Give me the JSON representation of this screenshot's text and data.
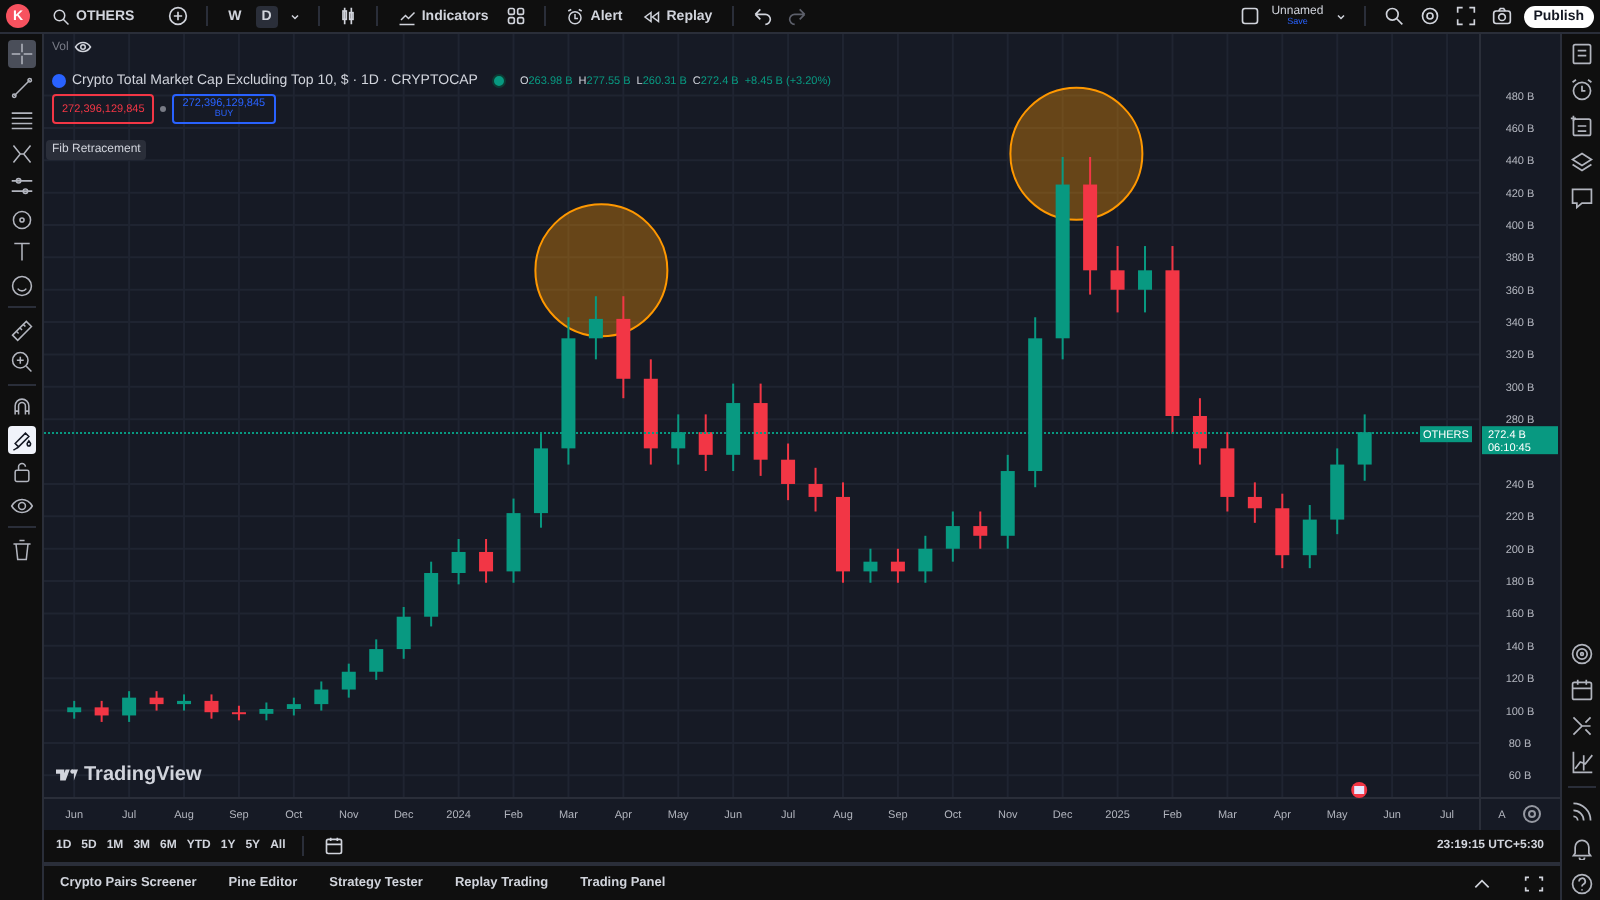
{
  "top_bar": {
    "avatar": "K",
    "symbol": "OTHERS",
    "intervals": [
      {
        "label": "W",
        "selected": false
      },
      {
        "label": "D",
        "selected": true
      }
    ],
    "indicators_label": "Indicators",
    "alert_label": "Alert",
    "replay_label": "Replay",
    "layout": {
      "name": "Unnamed",
      "status": "Save"
    },
    "publish_label": "Publish"
  },
  "left_toolbar": [
    {
      "kind": "crosshair",
      "selected": true,
      "on": false
    },
    {
      "kind": "trendline",
      "selected": false,
      "on": false
    },
    {
      "kind": "fib",
      "selected": false,
      "on": false
    },
    {
      "kind": "pattern",
      "selected": false,
      "on": false
    },
    {
      "kind": "sliders",
      "selected": false,
      "on": false
    },
    {
      "kind": "shapes",
      "selected": false,
      "on": false
    },
    {
      "kind": "text",
      "selected": false,
      "on": false
    },
    {
      "kind": "emoji",
      "selected": false,
      "on": false
    },
    {
      "kind": "ruler",
      "selected": false,
      "on": false
    },
    {
      "kind": "zoom",
      "selected": false,
      "on": false
    },
    {
      "kind": "magnet",
      "selected": false,
      "on": false
    },
    {
      "kind": "brush",
      "selected": false,
      "on": true
    },
    {
      "kind": "lock",
      "selected": false,
      "on": false
    },
    {
      "kind": "eye",
      "selected": false,
      "on": false
    },
    {
      "kind": "trash",
      "selected": false,
      "on": false
    }
  ],
  "chart": {
    "vol_label": "Vol",
    "legend": {
      "title": "Crypto Total Market Cap Excluding Top 10, $ · 1D · CRYPTOCAP",
      "ohlc": [
        {
          "key": "O",
          "value": "263.98 B"
        },
        {
          "key": "H",
          "value": "277.55 B"
        },
        {
          "key": "L",
          "value": "260.31 B"
        },
        {
          "key": "C",
          "value": "272.4 B"
        }
      ],
      "change": "+8.45 B (+3.20%)"
    },
    "sell_price": "272,396,129,845",
    "buy_price": "272,396,129,845",
    "buy_label": "BUY",
    "tooltip": "Fib Retracement",
    "symbol_tag": "OTHERS",
    "price_tag": "272.4 B",
    "countdown": "06:10:45",
    "logo": "TradingView",
    "chart_data": {
      "type": "candlestick",
      "categories": [
        "Jun",
        null,
        "Jul",
        null,
        "Aug",
        null,
        "Sep",
        null,
        "Oct",
        null,
        "Nov",
        null,
        "Dec",
        null,
        "2024",
        null,
        "Feb",
        null,
        "Mar",
        null,
        "Apr",
        null,
        "May",
        null,
        "Jun",
        null,
        "Jul",
        null,
        "Aug",
        null,
        "Sep",
        null,
        "Oct",
        null,
        "Nov",
        null,
        "Dec",
        null,
        "2025",
        null,
        "Feb",
        null,
        "Mar",
        null,
        "Apr",
        null,
        "May",
        null,
        "Jun",
        null,
        "Jul",
        null,
        "A"
      ],
      "ohlc": [
        [
          99,
          106,
          95,
          102
        ],
        [
          102,
          106,
          93,
          97
        ],
        [
          97,
          112,
          93,
          108
        ],
        [
          108,
          112,
          100,
          104
        ],
        [
          104,
          110,
          100,
          106
        ],
        [
          106,
          110,
          95,
          99
        ],
        [
          99,
          103,
          94,
          98
        ],
        [
          98,
          105,
          94,
          101
        ],
        [
          101,
          108,
          97,
          104
        ],
        [
          104,
          118,
          100,
          113
        ],
        [
          113,
          129,
          108,
          124
        ],
        [
          124,
          144,
          119,
          138
        ],
        [
          138,
          164,
          132,
          158
        ],
        [
          158,
          192,
          152,
          185
        ],
        [
          185,
          206,
          178,
          198
        ],
        [
          198,
          206,
          179,
          186
        ],
        [
          186,
          231,
          179,
          222
        ],
        [
          222,
          272,
          213,
          262
        ],
        [
          262,
          343,
          252,
          330
        ],
        [
          330,
          356,
          317,
          342
        ],
        [
          342,
          356,
          293,
          305
        ],
        [
          305,
          317,
          252,
          262
        ],
        [
          262,
          283,
          252,
          272
        ],
        [
          272,
          283,
          248,
          258
        ],
        [
          258,
          302,
          248,
          290
        ],
        [
          290,
          302,
          245,
          255
        ],
        [
          255,
          265,
          230,
          240
        ],
        [
          240,
          250,
          223,
          232
        ],
        [
          232,
          241,
          179,
          186
        ],
        [
          186,
          200,
          179,
          192
        ],
        [
          192,
          200,
          179,
          186
        ],
        [
          186,
          208,
          179,
          200
        ],
        [
          200,
          223,
          192,
          214
        ],
        [
          214,
          223,
          200,
          208
        ],
        [
          208,
          258,
          200,
          248
        ],
        [
          248,
          343,
          238,
          330
        ],
        [
          330,
          442,
          317,
          425
        ],
        [
          425,
          442,
          357,
          372
        ],
        [
          372,
          387,
          346,
          360
        ],
        [
          360,
          387,
          346,
          372
        ],
        [
          372,
          387,
          271,
          282
        ],
        [
          282,
          293,
          252,
          262
        ],
        [
          262,
          272,
          223,
          232
        ],
        [
          232,
          241,
          216,
          225
        ],
        [
          225,
          234,
          188,
          196
        ],
        [
          196,
          227,
          188,
          218
        ],
        [
          218,
          262,
          209,
          252
        ],
        [
          252,
          283,
          242,
          272
        ],
        null,
        null,
        null,
        null,
        null
      ],
      "ylim": [
        46,
        518
      ],
      "yticks": [
        {
          "value": 60,
          "label": "60 B"
        },
        {
          "value": 80,
          "label": "80 B"
        },
        {
          "value": 100,
          "label": "100 B"
        },
        {
          "value": 120,
          "label": "120 B"
        },
        {
          "value": 140,
          "label": "140 B"
        },
        {
          "value": 160,
          "label": "160 B"
        },
        {
          "value": 180,
          "label": "180 B"
        },
        {
          "value": 200,
          "label": "200 B"
        },
        {
          "value": 220,
          "label": "220 B"
        },
        {
          "value": 240,
          "label": "240 B"
        },
        {
          "value": 280,
          "label": "280 B"
        },
        {
          "value": 300,
          "label": "300 B"
        },
        {
          "value": 320,
          "label": "320 B"
        },
        {
          "value": 340,
          "label": "340 B"
        },
        {
          "value": 360,
          "label": "360 B"
        },
        {
          "value": 380,
          "label": "380 B"
        },
        {
          "value": 400,
          "label": "400 B"
        },
        {
          "value": 420,
          "label": "420 B"
        },
        {
          "value": 440,
          "label": "440 B"
        },
        {
          "value": 460,
          "label": "460 B"
        },
        {
          "value": 480,
          "label": "480 B"
        }
      ],
      "grid": true
    }
  },
  "range_buttons": [
    "1D",
    "5D",
    "1M",
    "3M",
    "6M",
    "YTD",
    "1Y",
    "5Y",
    "All"
  ],
  "clock": "23:19:15 UTC+5:30",
  "bottom_tabs": [
    "Crypto Pairs Screener",
    "Pine Editor",
    "Strategy Tester",
    "Replay Trading",
    "Trading Panel"
  ]
}
